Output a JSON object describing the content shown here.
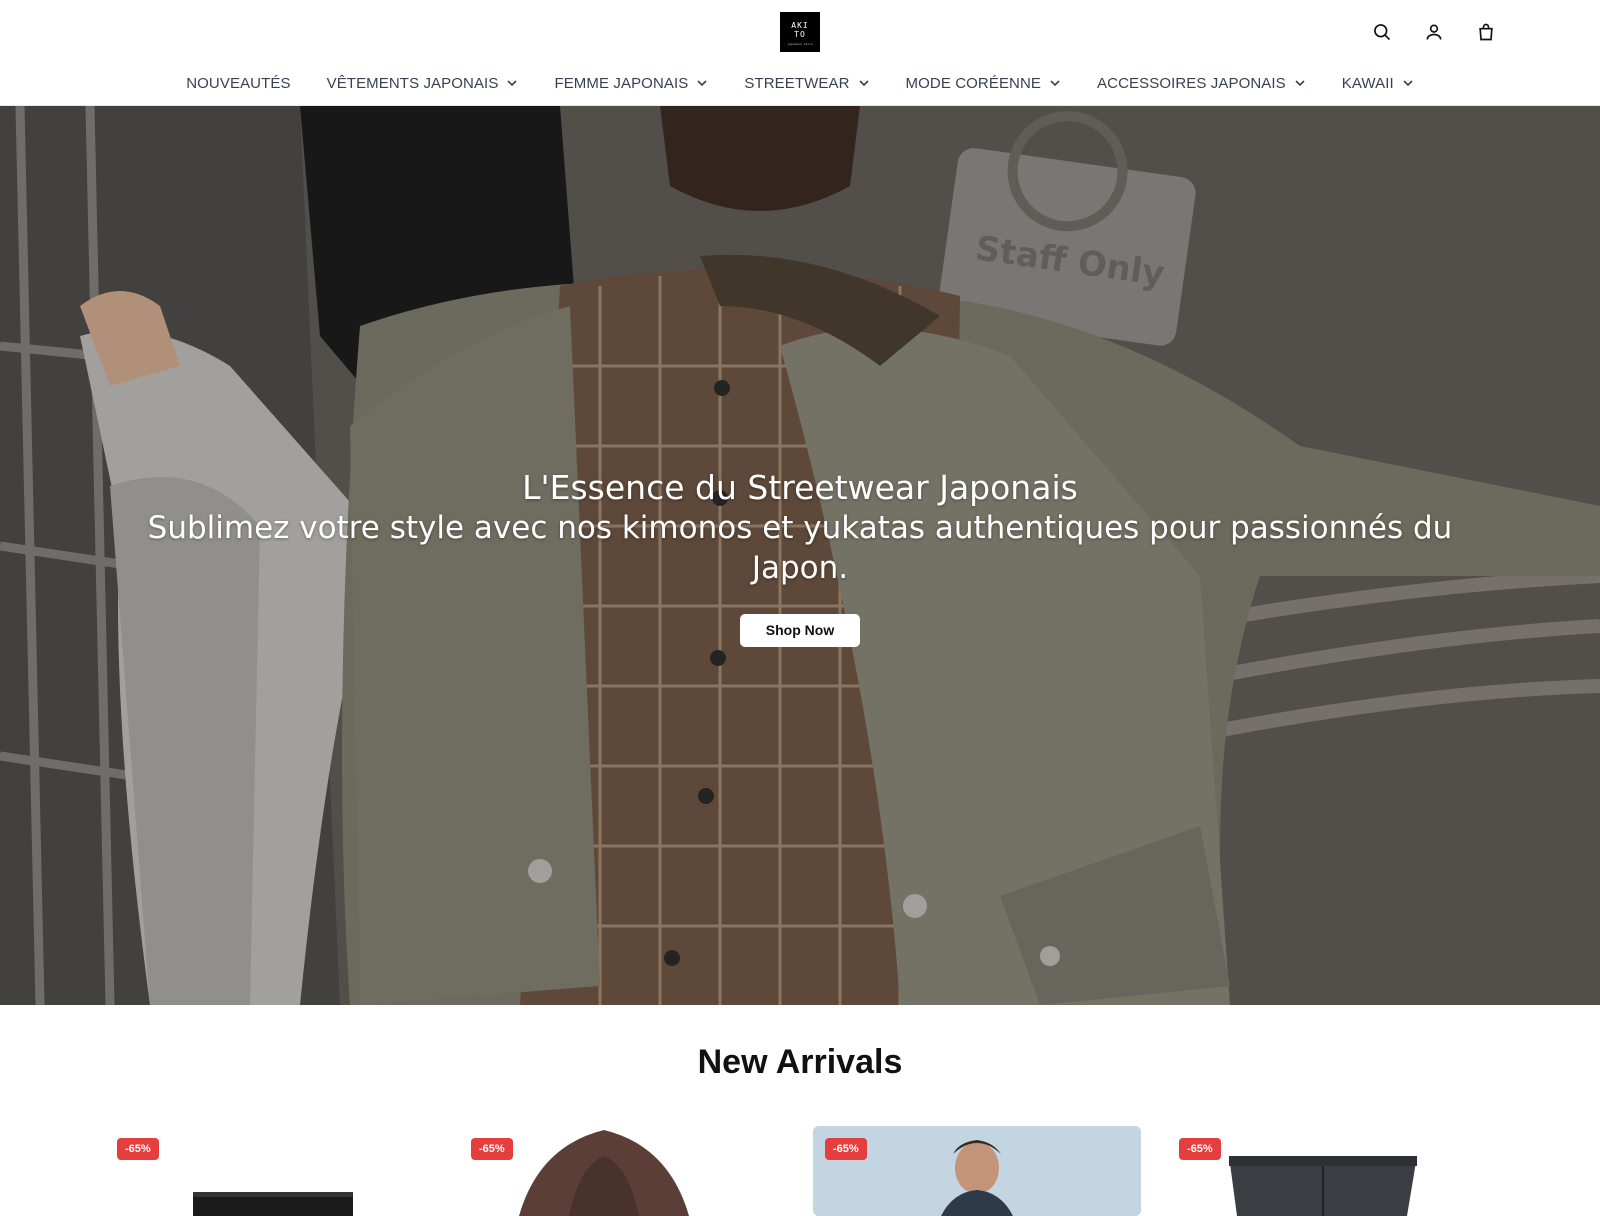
{
  "header": {
    "logo_text_line1": "AKI",
    "logo_text_line2": "TO",
    "logo_subtext": "japanese store",
    "icons": [
      "search-icon",
      "account-icon",
      "cart-icon"
    ]
  },
  "nav": {
    "items": [
      {
        "label": "NOUVEAUTÉS",
        "has_dropdown": false
      },
      {
        "label": "VÊTEMENTS JAPONAIS",
        "has_dropdown": true
      },
      {
        "label": "FEMME JAPONAIS",
        "has_dropdown": true
      },
      {
        "label": "STREETWEAR",
        "has_dropdown": true
      },
      {
        "label": "MODE CORÉENNE",
        "has_dropdown": true
      },
      {
        "label": "ACCESSOIRES JAPONAIS",
        "has_dropdown": true
      },
      {
        "label": "KAWAII",
        "has_dropdown": true
      }
    ]
  },
  "hero": {
    "title": "L'Essence du Streetwear Japonais",
    "subtitle": "Sublimez votre style avec nos kimonos et yukatas authentiques pour passionnés du Japon.",
    "button_label": "Shop Now",
    "sign_text": "Staff Only"
  },
  "new_arrivals": {
    "title": "New Arrivals",
    "products": [
      {
        "badge": "-65%",
        "image": "black-trousers"
      },
      {
        "badge": "-65%",
        "image": "brown-hoodie"
      },
      {
        "badge": "-65%",
        "image": "model-photo"
      },
      {
        "badge": "-65%",
        "image": "grey-cargo-shorts"
      }
    ]
  },
  "colors": {
    "badge": "#e53e3e",
    "nav_text": "#374151",
    "hero_button_bg": "#ffffff"
  }
}
